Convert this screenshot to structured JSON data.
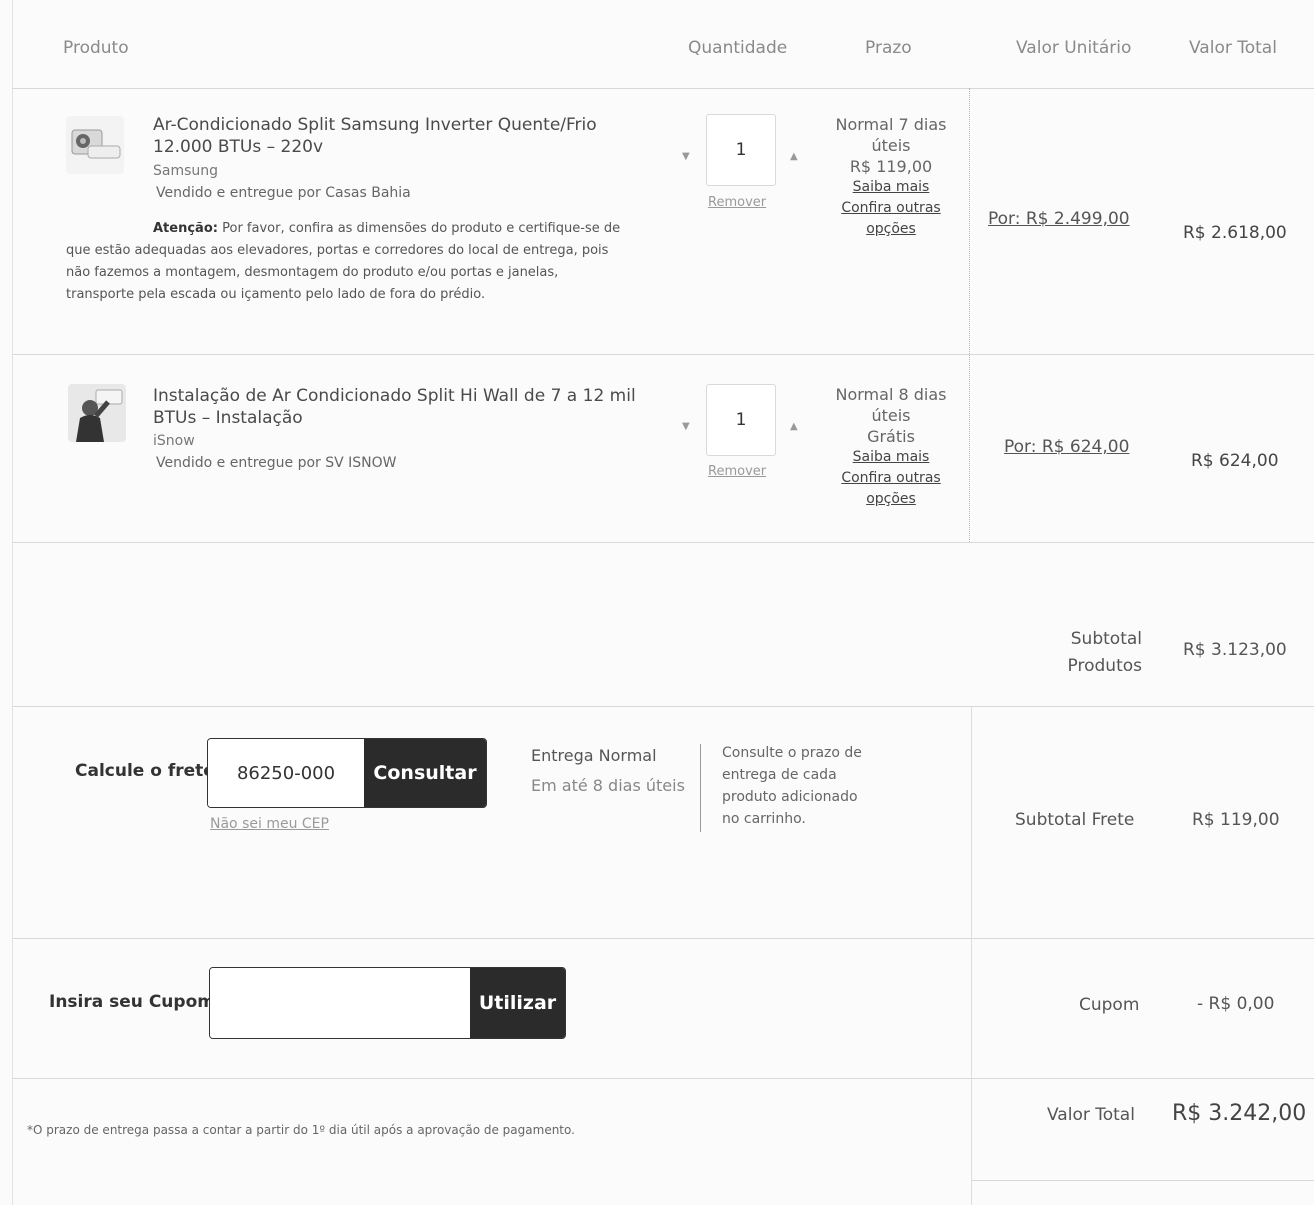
{
  "header": {
    "produto": "Produto",
    "quantidade": "Quantidade",
    "prazo": "Prazo",
    "valor_unitario": "Valor Unitário",
    "valor_total": "Valor Total"
  },
  "items": [
    {
      "name": "Ar-Condicionado Split Samsung Inverter Quente/Frio 12.000 BTUs – 220v",
      "brand": "Samsung",
      "seller": "Vendido e entregue por Casas Bahia",
      "warning_label": "Atenção:",
      "warning_text": "Por favor, confira as dimensões do produto e certifique-se de que estão adequadas aos elevadores, portas e corredores do local de entrega, pois não fazemos a montagem, desmontagem do produto e/ou portas e janelas, transporte pela escada ou içamento pelo lado de fora do prédio.",
      "quantity": "1",
      "remove_label": "Remover",
      "prazo_line1": "Normal 7 dias",
      "prazo_line2": "úteis",
      "prazo_price": "R$ 119,00",
      "saiba_mais": "Saiba mais",
      "confira_1": "Confira outras",
      "confira_2": "opções",
      "unit_price": "Por: R$ 2.499,00",
      "total_price": "R$ 2.618,00",
      "thumb_icon": "air-conditioner-image"
    },
    {
      "name": "Instalação de Ar Condicionado Split Hi Wall de 7 a 12 mil BTUs – Instalação",
      "brand": "iSnow",
      "seller": "Vendido e entregue por SV ISNOW",
      "quantity": "1",
      "remove_label": "Remover",
      "prazo_line1": "Normal 8 dias",
      "prazo_line2": "úteis",
      "prazo_price": "Grátis",
      "saiba_mais": "Saiba mais",
      "confira_1": "Confira outras",
      "confira_2": "opções",
      "unit_price": "Por: R$ 624,00",
      "total_price": "R$ 624,00",
      "thumb_icon": "installer-image"
    }
  ],
  "subtotal": {
    "label_line1": "Subtotal",
    "label_line2": "Produtos",
    "value": "R$ 3.123,00"
  },
  "frete": {
    "label": "Calcule o frete",
    "cep_value": "86250-000",
    "button": "Consultar",
    "nao_sei": "Não sei meu CEP",
    "entrega_title": "Entrega Normal",
    "entrega_sub": "Em até 8 dias úteis",
    "info_1": "Consulte o prazo de",
    "info_2": "entrega de cada",
    "info_3": "produto adicionado",
    "info_4": "no carrinho.",
    "subtotal_label": "Subtotal Frete",
    "subtotal_value": "R$ 119,00"
  },
  "cupom": {
    "label": "Insira seu Cupom",
    "input_value": "",
    "button": "Utilizar",
    "summary_label": "Cupom",
    "summary_value": "- R$ 0,00"
  },
  "footer": {
    "note": "*O prazo de entrega passa a contar a partir do 1º dia útil após a aprovação de pagamento.",
    "total_label": "Valor Total",
    "total_value": "R$ 3.242,00"
  }
}
